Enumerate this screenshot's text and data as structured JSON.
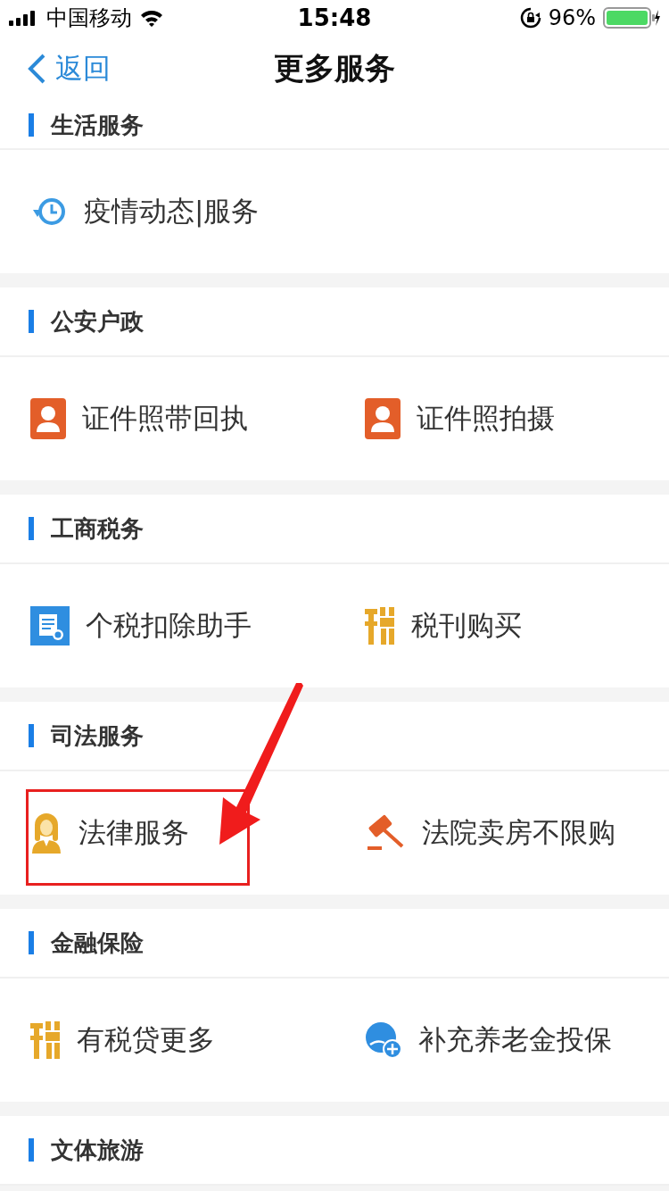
{
  "status_bar": {
    "carrier": "中国移动",
    "time": "15:48",
    "battery": "96%"
  },
  "nav": {
    "back": "返回",
    "title": "更多服务"
  },
  "sections": [
    {
      "title": "生活服务",
      "items": [
        {
          "label": "疫情动态|服务",
          "kind": "clock"
        }
      ]
    },
    {
      "title": "公安户政",
      "items": [
        {
          "label": "证件照带回执",
          "kind": "person"
        },
        {
          "label": "证件照拍摄",
          "kind": "person"
        }
      ]
    },
    {
      "title": "工商税务",
      "items": [
        {
          "label": "个税扣除助手",
          "kind": "doc"
        },
        {
          "label": "税刊购买",
          "kind": "tax"
        }
      ]
    },
    {
      "title": "司法服务",
      "items": [
        {
          "label": "法律服务",
          "kind": "judge"
        },
        {
          "label": "法院卖房不限购",
          "kind": "gavel"
        }
      ]
    },
    {
      "title": "金融保险",
      "items": [
        {
          "label": "有税贷更多",
          "kind": "tax"
        },
        {
          "label": "补充养老金投保",
          "kind": "pension"
        }
      ]
    },
    {
      "title": "文体旅游"
    }
  ]
}
